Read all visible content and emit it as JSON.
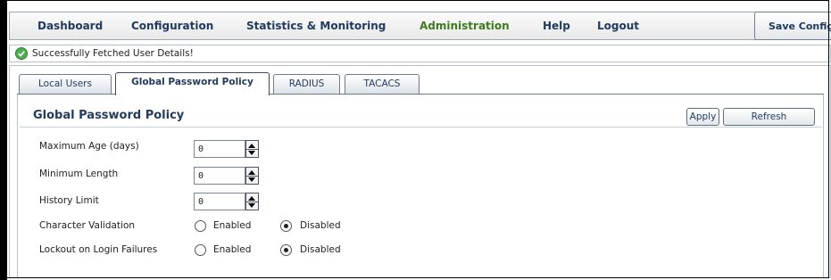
{
  "nav": {
    "items": [
      {
        "label": "Dashboard"
      },
      {
        "label": "Configuration"
      },
      {
        "label": "Statistics & Monitoring"
      },
      {
        "label": "Administration",
        "active": true
      },
      {
        "label": "Help"
      },
      {
        "label": "Logout"
      }
    ],
    "save_config": "Save Config"
  },
  "status": {
    "message": "Successfully Fetched User Details!",
    "icon": "success-check-icon",
    "color": "#4caf50"
  },
  "tabs": [
    {
      "label": "Local Users"
    },
    {
      "label": "Global Password Policy",
      "active": true
    },
    {
      "label": "RADIUS"
    },
    {
      "label": "TACACS"
    }
  ],
  "section": {
    "title": "Global Password Policy",
    "apply_label": "Apply",
    "refresh_label": "Refresh"
  },
  "fields": {
    "max_age": {
      "label": "Maximum Age (days)",
      "value": "0"
    },
    "min_length": {
      "label": "Minimum Length",
      "value": "0"
    },
    "history": {
      "label": "History Limit",
      "value": "0"
    }
  },
  "radios": {
    "char_validation": {
      "label": "Character Validation",
      "enabled": "Enabled",
      "disabled": "Disabled",
      "selected": "Disabled"
    },
    "lockout": {
      "label": "Lockout on Login Failures",
      "enabled": "Enabled",
      "disabled": "Disabled",
      "selected": "Disabled"
    }
  },
  "colors": {
    "nav_text": "#1f3a5e",
    "nav_active": "#3f7a1e",
    "border": "#b6c0cb"
  }
}
